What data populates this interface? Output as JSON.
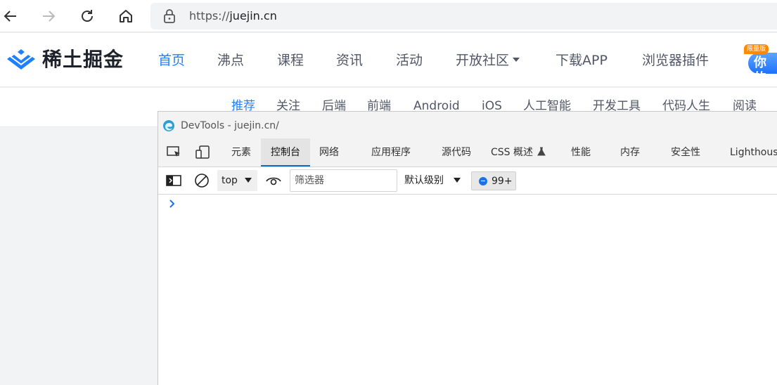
{
  "browser": {
    "url_scheme": "https://",
    "url_host": "juejin.cn"
  },
  "site": {
    "logo_text": "稀土掘金",
    "nav": [
      "首页",
      "沸点",
      "课程",
      "资讯",
      "活动",
      "开放社区",
      "下载APP",
      "浏览器插件"
    ],
    "active_nav": "首页",
    "promo_text": "你的",
    "promo_tag": "限量版",
    "sub_nav": [
      "推荐",
      "关注",
      "后端",
      "前端",
      "Android",
      "iOS",
      "人工智能",
      "开发工具",
      "代码人生",
      "阅读"
    ],
    "active_sub_nav": "推荐",
    "accent_color": "#1e80ff"
  },
  "devtools": {
    "title": "DevTools - juejin.cn/",
    "tabs": [
      "元素",
      "控制台",
      "网络",
      "应用程序",
      "源代码",
      "CSS 概述",
      "性能",
      "内存",
      "安全性",
      "Lighthouse"
    ],
    "active_tab": "控制台",
    "toolbar": {
      "context": "top",
      "filter_placeholder": "筛选器",
      "level": "默认级别",
      "message_count": "99+"
    },
    "icons": [
      "inspect-element-icon",
      "device-emulation-icon",
      "sidebar-toggle-icon",
      "clear-console-icon",
      "live-expression-eye-icon",
      "experimental-flask-icon",
      "console-prompt-chevron-icon"
    ]
  }
}
